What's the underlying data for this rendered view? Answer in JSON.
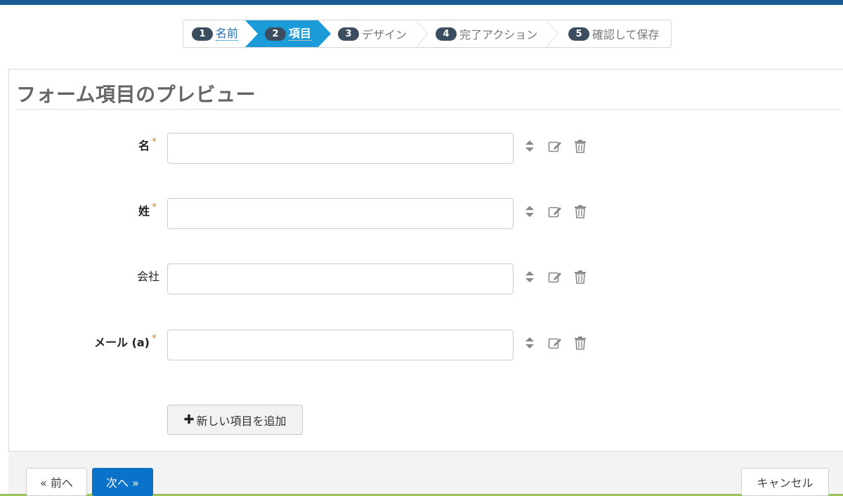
{
  "wizard": {
    "steps": [
      {
        "num": "1",
        "label": "名前",
        "state": "done"
      },
      {
        "num": "2",
        "label": "項目",
        "state": "active"
      },
      {
        "num": "3",
        "label": "デザイン",
        "state": "todo"
      },
      {
        "num": "4",
        "label": "完了アクション",
        "state": "todo"
      },
      {
        "num": "5",
        "label": "確認して保存",
        "state": "todo"
      }
    ]
  },
  "panel": {
    "title": "フォーム項目のプレビュー"
  },
  "fields": [
    {
      "label": "名",
      "required": true,
      "value": ""
    },
    {
      "label": "姓",
      "required": true,
      "value": ""
    },
    {
      "label": "会社",
      "required": false,
      "value": ""
    },
    {
      "label": "メール (a)",
      "required": true,
      "value": ""
    }
  ],
  "required_mark": "*",
  "add_button": {
    "plus": "✚",
    "label": "新しい項目を追加"
  },
  "footer": {
    "prev_label": "« 前へ",
    "next_label": "次へ »",
    "cancel_label": "キャンセル"
  },
  "colors": {
    "accent": "#0a72c8",
    "active_step": "#1b9bd8",
    "required_star": "#e08a1e",
    "top_stripe": "#1a5b94"
  }
}
